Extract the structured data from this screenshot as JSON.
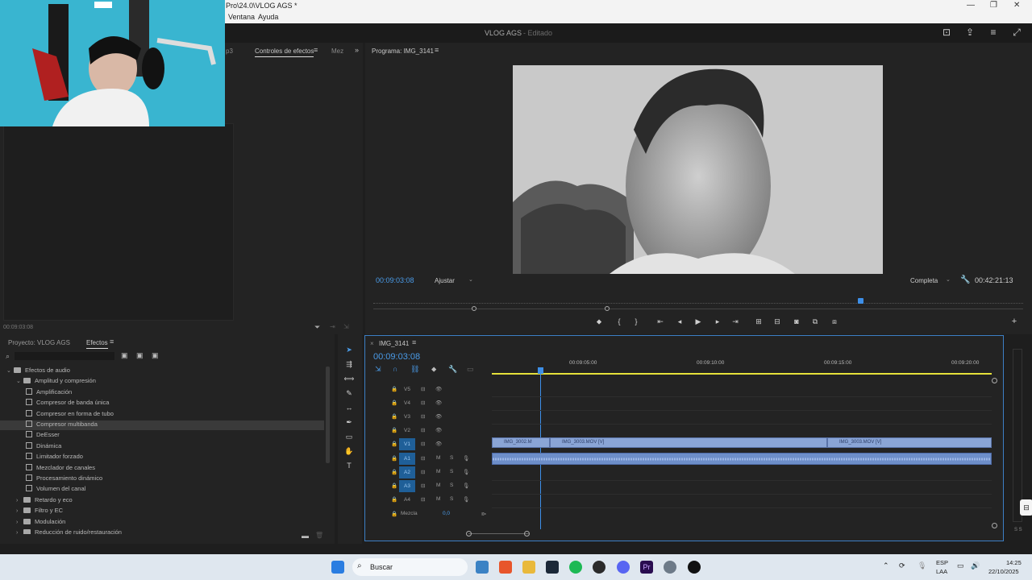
{
  "window": {
    "title": "Pro\\24.0\\VLOG AGS *",
    "menu": [
      "Ventana",
      "Ayuda"
    ],
    "controls": [
      "—",
      "❐",
      "✕"
    ]
  },
  "header": {
    "project_name": "VLOG AGS",
    "status": "- Editado"
  },
  "effects_controls_panel": {
    "tabs": [
      "Controles de efectos",
      "Mez"
    ],
    "prev_tab_fragment": "p3",
    "timecode": "00:09:03:08"
  },
  "program_monitor": {
    "title": "Programa: IMG_3141",
    "current_timecode": "00:09:03:08",
    "fit_label": "Ajustar",
    "quality_label": "Completa",
    "duration": "00:42:21:13"
  },
  "project_panel": {
    "tabs": [
      "Proyecto: VLOG AGS",
      "Efectos"
    ],
    "search_placeholder": "",
    "tree": [
      {
        "label": "Efectos de audio",
        "type": "folder",
        "level": 0,
        "open": true
      },
      {
        "label": "Amplitud y compresión",
        "type": "folder",
        "level": 1,
        "open": true
      },
      {
        "label": "Amplificación",
        "type": "effect",
        "level": 2
      },
      {
        "label": "Compresor de banda única",
        "type": "effect",
        "level": 2
      },
      {
        "label": "Compresor en forma de tubo",
        "type": "effect",
        "level": 2
      },
      {
        "label": "Compresor multibanda",
        "type": "effect",
        "level": 2,
        "selected": true
      },
      {
        "label": "DeEsser",
        "type": "effect",
        "level": 2
      },
      {
        "label": "Dinámica",
        "type": "effect",
        "level": 2
      },
      {
        "label": "Limitador forzado",
        "type": "effect",
        "level": 2
      },
      {
        "label": "Mezclador de canales",
        "type": "effect",
        "level": 2
      },
      {
        "label": "Procesamiento dinámico",
        "type": "effect",
        "level": 2
      },
      {
        "label": "Volumen del canal",
        "type": "effect",
        "level": 2
      },
      {
        "label": "Retardo y eco",
        "type": "folder",
        "level": 1
      },
      {
        "label": "Filtro y EC",
        "type": "folder",
        "level": 1
      },
      {
        "label": "Modulación",
        "type": "folder",
        "level": 1
      },
      {
        "label": "Reducción de ruido/restauración",
        "type": "folder",
        "level": 1
      }
    ]
  },
  "timeline": {
    "sequence_name": "IMG_3141",
    "timecode": "00:09:03:08",
    "ruler_labels": [
      "00:09:05:00",
      "00:09:10:00",
      "00:09:15:00",
      "00:09:20:00"
    ],
    "video_tracks": [
      "V5",
      "V4",
      "V3",
      "V2",
      "V1"
    ],
    "audio_tracks": [
      "A1",
      "A2",
      "A3",
      "A4"
    ],
    "mix_label": "Mezcla",
    "mix_value": "0,0",
    "track_buttons": {
      "mute": "M",
      "solo": "S"
    },
    "clips": [
      {
        "name": "IMG_3002.M"
      },
      {
        "name": "IMG_3003.MOV [V]"
      },
      {
        "name": "IMG_3003.MOV [V]"
      }
    ]
  },
  "taskbar": {
    "search_label": "Buscar",
    "lang": "ESP",
    "lang_sub": "LAA",
    "time": "14:25",
    "date": "22/10/2025"
  },
  "colors": {
    "accent_blue": "#3d7fc5",
    "timecode_blue": "#4a9be8",
    "clip_blue": "#8aa5d6",
    "workarea_yellow": "#e5e03a"
  }
}
